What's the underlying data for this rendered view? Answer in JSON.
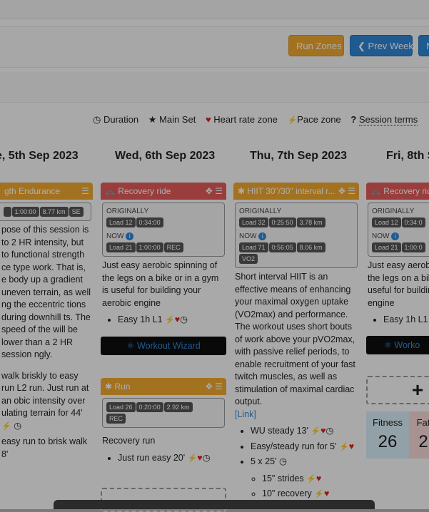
{
  "toolbar": {
    "run_zones": "Run Zones",
    "prev_week": "Prev Week",
    "next_partial": "N"
  },
  "legend": {
    "duration": "Duration",
    "main_set": "Main Set",
    "hr_zone": "Heart rate zone",
    "pace_zone": "Pace zone",
    "session_terms": "Session terms"
  },
  "days": [
    "e, 5th Sep 2023",
    "Wed, 6th Sep 2023",
    "Thu, 7th Sep 2023",
    "Fri, 8th S"
  ],
  "col1": {
    "head": "gth Endurance",
    "chips": [
      "1:00:00",
      "8.77 km",
      "SE"
    ],
    "text": "pose of this session is to 2 HR intensity, but to functional strength ce type work. That is, e body up a gradient uneven terrain, as well ng the eccentric tions during downhill ts. The speed of the will be lower than a 2 HR session ngly.",
    "item1": "walk briskly to easy run L2 run. Just run at an obic intensity over ulating terrain for 44'",
    "item2": "easy run to brisk walk 8'"
  },
  "col2": {
    "card1_title": "Recovery ride",
    "originally": "ORIGINALLY",
    "orig_chips": [
      "Load 12",
      "0:34:00"
    ],
    "now": "NOW",
    "now_chips": [
      "Load 21",
      "1:00:00",
      "REC"
    ],
    "desc": "Just easy aerobic spinning of the legs on a bike or in a gym is useful for building your aerobic engine",
    "bullet": "Easy 1h L1",
    "wizard": "Workout Wizard",
    "card2_title": "Run",
    "card2_chips": [
      "Load 26",
      "0:20:00",
      "2.92 km",
      "REC"
    ],
    "card2_desc": "Recovery run",
    "card2_bullet": "Just run easy 20'"
  },
  "col3": {
    "title": "HIIT 30\"/30\" interval r...",
    "originally": "ORIGINALLY",
    "orig_chips": [
      "Load 32",
      "0:25:50",
      "3.78 km"
    ],
    "now": "NOW",
    "now_chips": [
      "Load 71",
      "0:56:05",
      "8.06 km",
      "VO2"
    ],
    "desc": "Short interval HIIT is an effective means of enhancing your maximal oxygen uptake (VO2max) and performance. The workout uses short bouts of work above your pVO2max, with passive relief periods, to enable recruitment of your fast twitch muscles, as well as stimulation of maximal cardiac output.",
    "link": "[Link]",
    "b1": "WU steady 13'",
    "b2": "Easy/steady run for 5'",
    "b3": "5 x 25'",
    "b3a": "15\" strides",
    "b3b": "10\" recovery"
  },
  "col4": {
    "title": "Recovery rid",
    "originally": "ORIGINALLY",
    "orig_chips": [
      "Load 12",
      "0:34:0"
    ],
    "now": "NOW",
    "now_chips": [
      "Load 21",
      "1:00:0"
    ],
    "desc": "Just easy aerobi the legs on a bik useful for buildin engine",
    "bullet": "Easy 1h L1",
    "wizard": "Worko",
    "fitness_label": "Fitness",
    "fitness_value": "26",
    "fatigue_label": "Fat",
    "fatigue_value": "2"
  },
  "colors": {
    "accent_blue": "#2f86d6",
    "orange": "#f0a830",
    "red": "#e25a5a"
  }
}
